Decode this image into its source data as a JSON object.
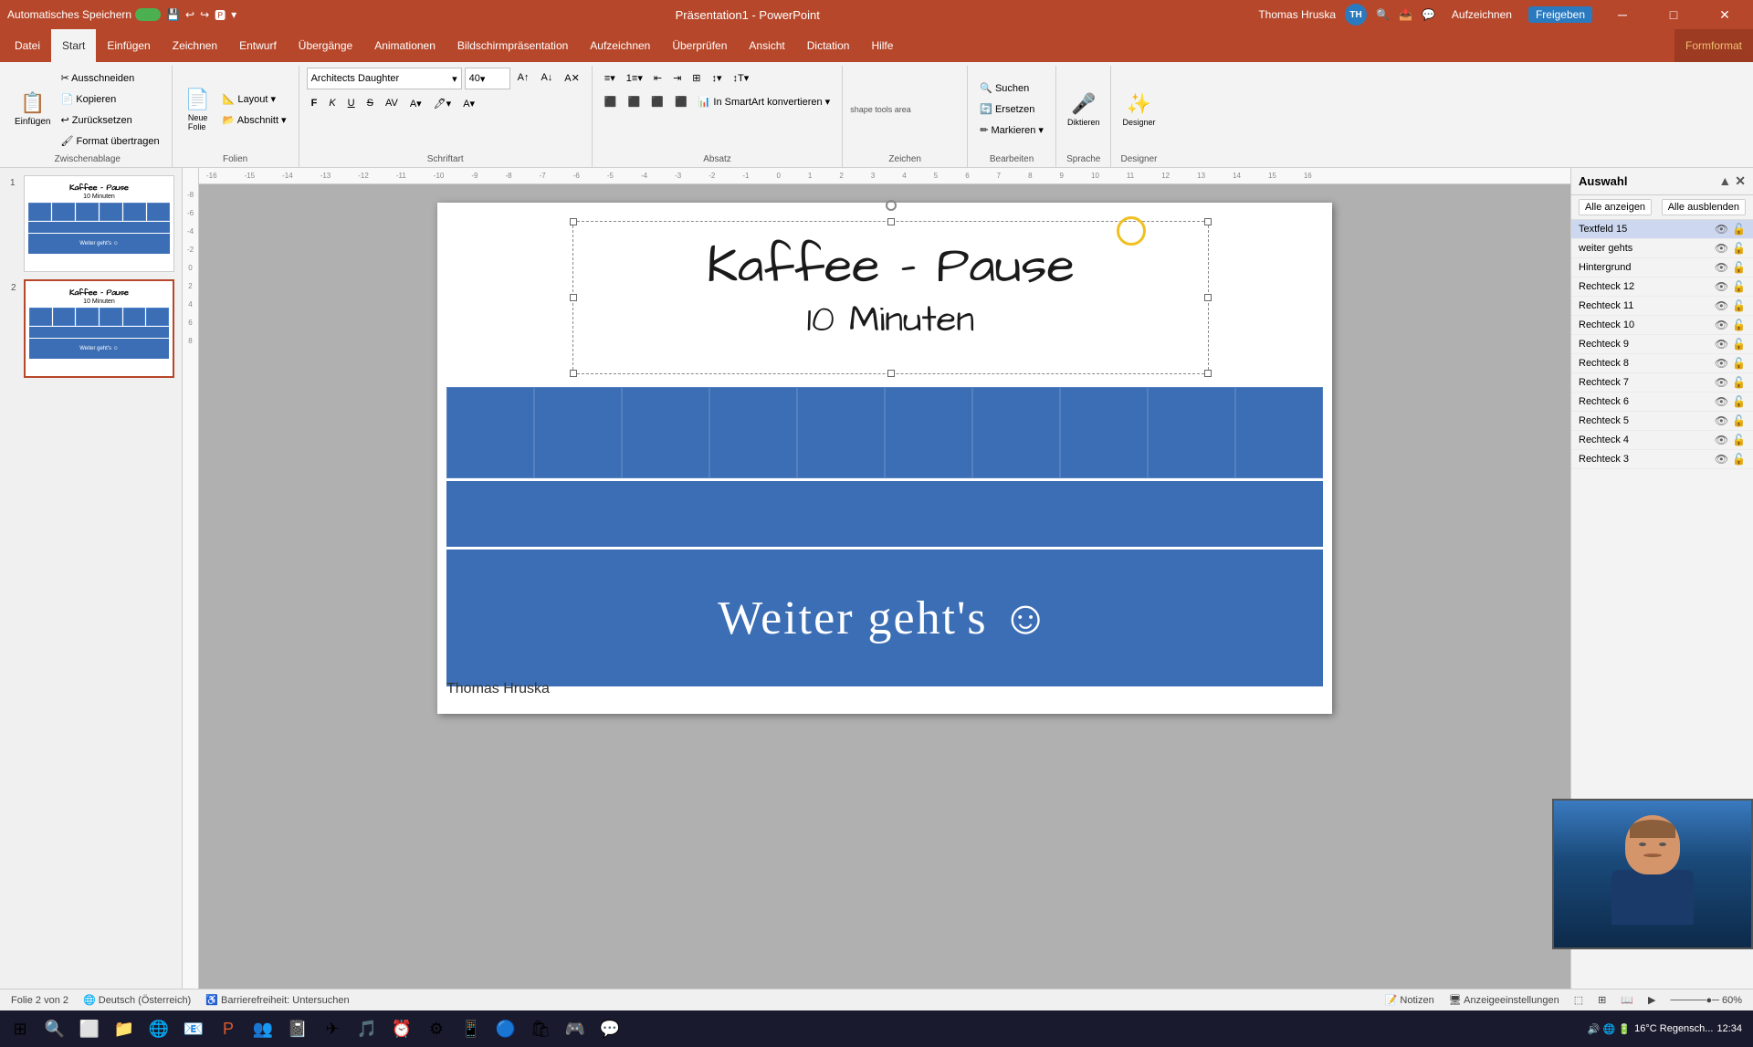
{
  "titlebar": {
    "app_name": "PowerPoint",
    "doc_name": "Präsentation1",
    "full_title": "Präsentation1 - PowerPoint",
    "autosave_label": "Automatisches Speichern",
    "user_name": "Thomas Hruska",
    "user_initials": "TH",
    "min_btn": "─",
    "max_btn": "□",
    "close_btn": "✕"
  },
  "ribbon": {
    "tabs": [
      "Datei",
      "Start",
      "Einfügen",
      "Zeichnen",
      "Entwurf",
      "Übergänge",
      "Animationen",
      "Bildschirmpräsentation",
      "Aufzeichnen",
      "Überprüfen",
      "Ansicht",
      "Dictation",
      "Hilfe",
      "Formformat"
    ],
    "active_tab": "Start",
    "format_tab": "Formformat",
    "groups": {
      "zwischenablage": {
        "label": "Zwischenablage",
        "buttons": [
          "Einfügen",
          "Ausschneiden",
          "Kopieren",
          "Zurücksetzen",
          "Format übertragen"
        ]
      },
      "folien": {
        "label": "Folien",
        "buttons": [
          "Neue Folie",
          "Layout",
          "Abschnitt"
        ]
      },
      "schriftart": {
        "label": "Schriftart",
        "font_name": "Architects Daughter",
        "font_size": "40",
        "buttons": [
          "F",
          "K",
          "U",
          "S",
          "AV",
          "A"
        ]
      },
      "absatz": {
        "label": "Absatz"
      },
      "zeichen": {
        "label": "Zeichen"
      },
      "bearbeiten": {
        "label": "Bearbeiten",
        "buttons": [
          "Suchen",
          "Ersetzen",
          "Markieren"
        ]
      },
      "sprache": {
        "label": "Sprache",
        "buttons": [
          "Diktieren"
        ]
      },
      "designer": {
        "label": "Designer",
        "buttons": [
          "Designer"
        ]
      }
    }
  },
  "slides_panel": {
    "slides": [
      {
        "num": 1,
        "title": "Kaffee - Pause",
        "subtitle": "10 Minuten",
        "active": false
      },
      {
        "num": 2,
        "title": "Kaffee - Pause",
        "subtitle": "10 Minuten",
        "active": true
      }
    ]
  },
  "slide": {
    "title": "Kaffee - Pause",
    "subtitle": "10 Minuten",
    "bottom_text": "Weiter geht's ☺",
    "author": "Thomas Hruska",
    "weiter_text": "Weiter geht's ☺"
  },
  "selection_panel": {
    "title": "Auswahl",
    "show_all_btn": "Alle anzeigen",
    "hide_all_btn": "Alle ausblenden",
    "items": [
      {
        "name": "Textfeld 15",
        "highlighted": true
      },
      {
        "name": "weiter gehts",
        "highlighted": false
      },
      {
        "name": "Hintergrund",
        "highlighted": false
      },
      {
        "name": "Rechteck 12",
        "highlighted": false
      },
      {
        "name": "Rechteck 11",
        "highlighted": false
      },
      {
        "name": "Rechteck 10",
        "highlighted": false
      },
      {
        "name": "Rechteck 9",
        "highlighted": false
      },
      {
        "name": "Rechteck 8",
        "highlighted": false
      },
      {
        "name": "Rechteck 7",
        "highlighted": false
      },
      {
        "name": "Rechteck 6",
        "highlighted": false
      },
      {
        "name": "Rechteck 5",
        "highlighted": false
      },
      {
        "name": "Rechteck 4",
        "highlighted": false
      },
      {
        "name": "Rechteck 3",
        "highlighted": false
      }
    ]
  },
  "statusbar": {
    "slide_info": "Folie 2 von 2",
    "language": "Deutsch (Österreich)",
    "accessibility": "Barrierefreiheit: Untersuchen",
    "notes": "Notizen",
    "display_settings": "Anzeigeeinstellungen"
  },
  "taskbar": {
    "weather": "16°C  Regensch...",
    "time": "12:34",
    "icons": [
      "⊞",
      "⬜",
      "🔍",
      "📁",
      "🌐",
      "💻",
      "📧",
      "🎵",
      "📷",
      "⚙",
      "🔧",
      "📊",
      "📋",
      "📌",
      "🔵",
      "📦",
      "🌀",
      "📺",
      "🎮",
      "💬",
      "🔴"
    ]
  }
}
